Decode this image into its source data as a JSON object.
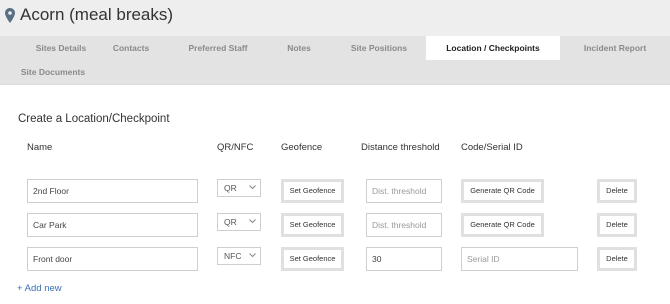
{
  "header": {
    "title": "Acorn (meal breaks)"
  },
  "tabs": [
    {
      "label": "Sites Details"
    },
    {
      "label": "Contacts"
    },
    {
      "label": "Preferred Staff"
    },
    {
      "label": "Notes"
    },
    {
      "label": "Site Positions"
    },
    {
      "label": "Location / Checkpoints",
      "active": true
    },
    {
      "label": "Incident Report"
    },
    {
      "label": "Site Documents"
    }
  ],
  "section": {
    "title": "Create a Location/Checkpoint"
  },
  "columns": {
    "name": "Name",
    "qr_nfc": "QR/NFC",
    "geofence": "Geofence",
    "distance": "Distance threshold",
    "code": "Code/Serial ID"
  },
  "rows": [
    {
      "name": "2nd Floor",
      "type": "QR",
      "geofence_label": "Set Geofence",
      "distance_value": "",
      "distance_placeholder": "Dist. threshold",
      "code_button": "Generate QR Code",
      "delete_label": "Delete"
    },
    {
      "name": "Car Park",
      "type": "QR",
      "geofence_label": "Set Geofence",
      "distance_value": "",
      "distance_placeholder": "Dist. threshold",
      "code_button": "Generate QR Code",
      "delete_label": "Delete"
    },
    {
      "name": "Front door",
      "type": "NFC",
      "geofence_label": "Set Geofence",
      "distance_value": "30",
      "serial_placeholder": "Serial ID",
      "delete_label": "Delete"
    }
  ],
  "add_new": "+ Add new",
  "colors": {
    "link": "#3a6fb5",
    "active_tab_bg": "#ffffff",
    "tab_bar_bg": "#e3e3e3"
  },
  "icons": {
    "header": "map-pin-icon",
    "select": "chevron-down-icon"
  }
}
